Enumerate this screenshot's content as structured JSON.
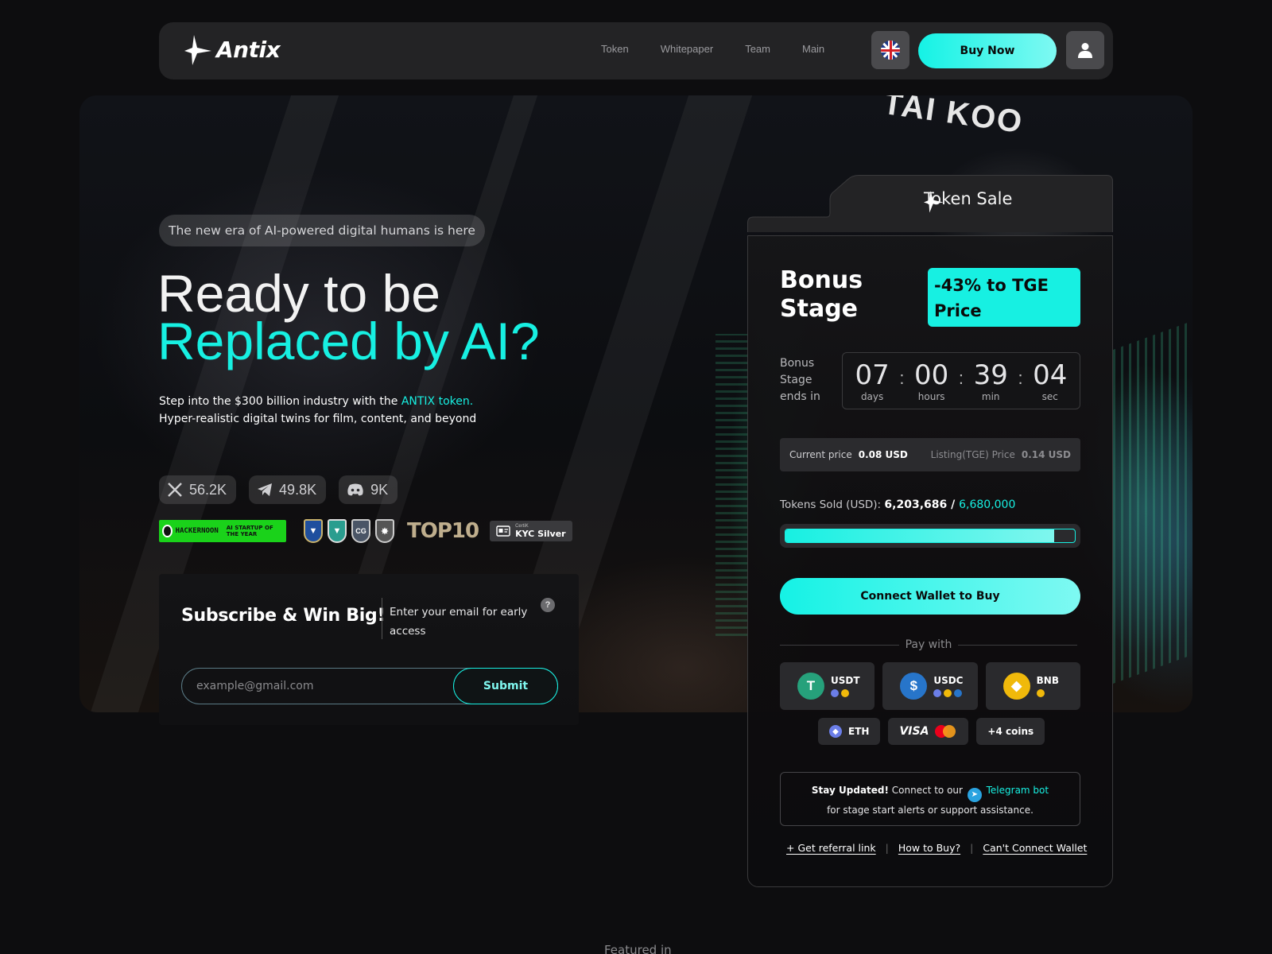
{
  "header": {
    "logo_text": "Antix",
    "nav": [
      "Token",
      "Whitepaper",
      "Team",
      "Main"
    ],
    "buy_now": "Buy Now",
    "language": "English (UK)"
  },
  "hero": {
    "tagline": "The new era of AI-powered digital humans is here",
    "title_line1": "Ready to be",
    "title_line2": "Replaced by AI?",
    "sub_line1_prefix": "Step into the $300 billion industry with the ",
    "sub_line1_highlight": "ANTIX token.",
    "sub_line2": "Hyper-realistic digital twins for film, content, and beyond",
    "background_sign": "TAI KOO"
  },
  "socials": [
    {
      "icon": "x-icon",
      "count": "56.2K"
    },
    {
      "icon": "telegram-icon",
      "count": "49.8K"
    },
    {
      "icon": "discord-icon",
      "count": "9K"
    }
  ],
  "badges": {
    "hackernoon": "HACKERNOON",
    "hackernoon_award": "AI STARTUP OF THE YEAR",
    "top10": "TOP10",
    "kyc_top": "CertiK",
    "kyc_main": "KYC Silver"
  },
  "subscribe": {
    "title": "Subscribe & Win Big!",
    "description": "Enter your email for early access",
    "help": "?",
    "email_placeholder": "example@gmail.com",
    "submit": "Submit"
  },
  "token_sale": {
    "tab_label": "Token Sale",
    "stage_title_line1": "Bonus",
    "stage_title_line2": "Stage",
    "tge_badge": "-43% to TGE Price",
    "ends_label": "Bonus Stage ends in",
    "countdown": [
      {
        "value": "07",
        "unit": "days"
      },
      {
        "value": "00",
        "unit": "hours"
      },
      {
        "value": "39",
        "unit": "min"
      },
      {
        "value": "04",
        "unit": "sec"
      }
    ],
    "current_price_label": "Current price",
    "current_price": "0.08 USD",
    "listing_price_label": "Listing(TGE) Price",
    "listing_price": "0.14 USD",
    "sold_label": "Tokens Sold (USD):",
    "sold_value": "6,203,686",
    "sold_sep": " / ",
    "sold_goal": "6,680,000",
    "progress_fraction": 0.9287,
    "connect_button": "Connect Wallet to Buy",
    "pay_with": "Pay with",
    "coins": [
      {
        "name": "USDT",
        "icon": "usdt-icon",
        "color": "#26a17b",
        "glyph": "T",
        "networks": [
          "#6b7ee8",
          "#f0b90b"
        ]
      },
      {
        "name": "USDC",
        "icon": "usdc-icon",
        "color": "#2775ca",
        "glyph": "$",
        "networks": [
          "#6b7ee8",
          "#f0b90b",
          "#2775ca"
        ]
      },
      {
        "name": "BNB",
        "icon": "bnb-icon",
        "color": "#f0b90b",
        "glyph": "◆",
        "networks": [
          "#f0b90b"
        ]
      }
    ],
    "eth": "ETH",
    "visa": "VISA",
    "more_coins": "+4 coins",
    "updated_bold": "Stay Updated!",
    "updated_text": " Connect to our ",
    "updated_link": "Telegram bot",
    "updated_line2": "for stage start alerts or support assistance.",
    "links": [
      "+ Get referral link",
      "How to Buy?",
      "Can't Connect Wallet"
    ]
  },
  "featured": "Featured in",
  "colors": {
    "accent": "#17f0e2",
    "panel": "#232325"
  }
}
